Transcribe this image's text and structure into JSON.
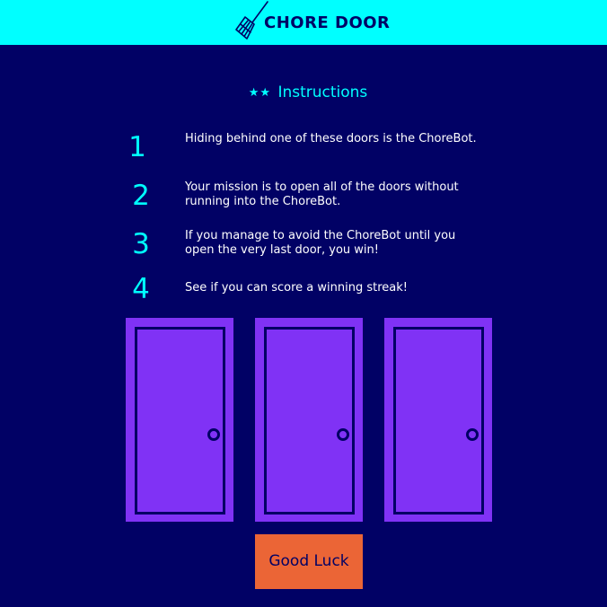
{
  "header": {
    "title": "CHORE DOOR",
    "logo_icon": "broom-icon",
    "background": "#00ffff"
  },
  "instructions": {
    "heading": "Instructions",
    "stars": "★★",
    "steps": [
      {
        "number": "1",
        "text": "Hiding behind one of these doors is the ChoreBot."
      },
      {
        "number": "2",
        "text": "Your mission is to open all of the doors without running into the ChoreBot."
      },
      {
        "number": "3",
        "text": "If you manage to avoid the ChoreBot until you open the very last door, you win!"
      },
      {
        "number": "4",
        "text": "See if you can score a winning streak!"
      }
    ]
  },
  "doors": [
    {
      "state": "closed"
    },
    {
      "state": "closed"
    },
    {
      "state": "closed"
    }
  ],
  "start_button": {
    "label": "Good Luck",
    "color": "#eb6536"
  },
  "colors": {
    "background": "#010165",
    "accent": "#00ffff",
    "door": "#8032f5",
    "text": "#ffffff"
  }
}
